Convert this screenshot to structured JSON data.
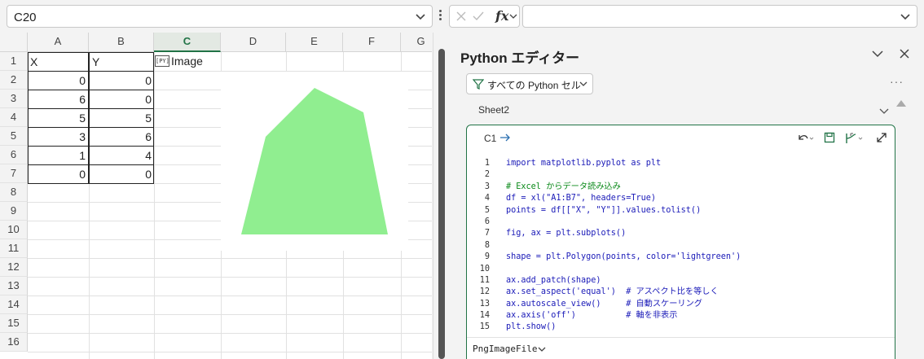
{
  "formula_bar": {
    "name_box": "C20",
    "formula_text": "",
    "fx_label": "fx"
  },
  "grid": {
    "columns": [
      "A",
      "B",
      "C",
      "D",
      "E",
      "F",
      "G"
    ],
    "selected_column": "C",
    "rows": [
      "1",
      "2",
      "3",
      "4",
      "5",
      "6",
      "7",
      "8",
      "9",
      "10",
      "11",
      "12",
      "13",
      "14",
      "15",
      "16"
    ],
    "headers": {
      "a1": "X",
      "b1": "Y"
    },
    "data": [
      [
        "0",
        "0"
      ],
      [
        "6",
        "0"
      ],
      [
        "5",
        "5"
      ],
      [
        "3",
        "6"
      ],
      [
        "1",
        "4"
      ],
      [
        "0",
        "0"
      ]
    ],
    "c1_icon": "[PY]",
    "c1_text": "Image"
  },
  "chart_data": {
    "type": "polygon",
    "points": [
      [
        0,
        0
      ],
      [
        6,
        0
      ],
      [
        5,
        5
      ],
      [
        3,
        6
      ],
      [
        1,
        4
      ],
      [
        0,
        0
      ]
    ],
    "color": "lightgreen",
    "fill_hex": "#90ee90",
    "axis": "off",
    "aspect": "equal"
  },
  "editor": {
    "title": "Python エディター",
    "filter_label": "すべての Python セル",
    "more": "···",
    "sheet": "Sheet2",
    "cell_ref": "C1",
    "code_lines": [
      {
        "n": "1",
        "t": "import matplotlib.pyplot as plt",
        "c": false
      },
      {
        "n": "2",
        "t": "",
        "c": false
      },
      {
        "n": "3",
        "t": "# Excel からデータ読み込み",
        "c": true
      },
      {
        "n": "4",
        "t": "df = xl(\"A1:B7\", headers=True)",
        "c": false
      },
      {
        "n": "5",
        "t": "points = df[[\"X\", \"Y\"]].values.tolist()",
        "c": false
      },
      {
        "n": "6",
        "t": "",
        "c": false
      },
      {
        "n": "7",
        "t": "fig, ax = plt.subplots()",
        "c": false
      },
      {
        "n": "8",
        "t": "",
        "c": false
      },
      {
        "n": "9",
        "t": "shape = plt.Polygon(points, color='lightgreen')",
        "c": false
      },
      {
        "n": "10",
        "t": "",
        "c": false
      },
      {
        "n": "11",
        "t": "ax.add_patch(shape)",
        "c": false
      },
      {
        "n": "12",
        "t": "ax.set_aspect('equal')  # アスペクト比を等しく",
        "c": false
      },
      {
        "n": "13",
        "t": "ax.autoscale_view()     # 自動スケーリング",
        "c": false
      },
      {
        "n": "14",
        "t": "ax.axis('off')          # 軸を非表示",
        "c": false
      },
      {
        "n": "15",
        "t": "plt.show()",
        "c": false
      }
    ],
    "output_type": "PngImageFile"
  },
  "colors": {
    "accent": "#217346",
    "code_keyword": "#1a1ab8",
    "code_comment": "#0b8a1a"
  },
  "icons": [
    "chevron-down-icon",
    "cancel-icon",
    "check-icon",
    "fx-icon",
    "filter-icon",
    "close-icon",
    "undo-icon",
    "save-icon",
    "run-icon",
    "expand-icon",
    "arrow-right-icon"
  ]
}
